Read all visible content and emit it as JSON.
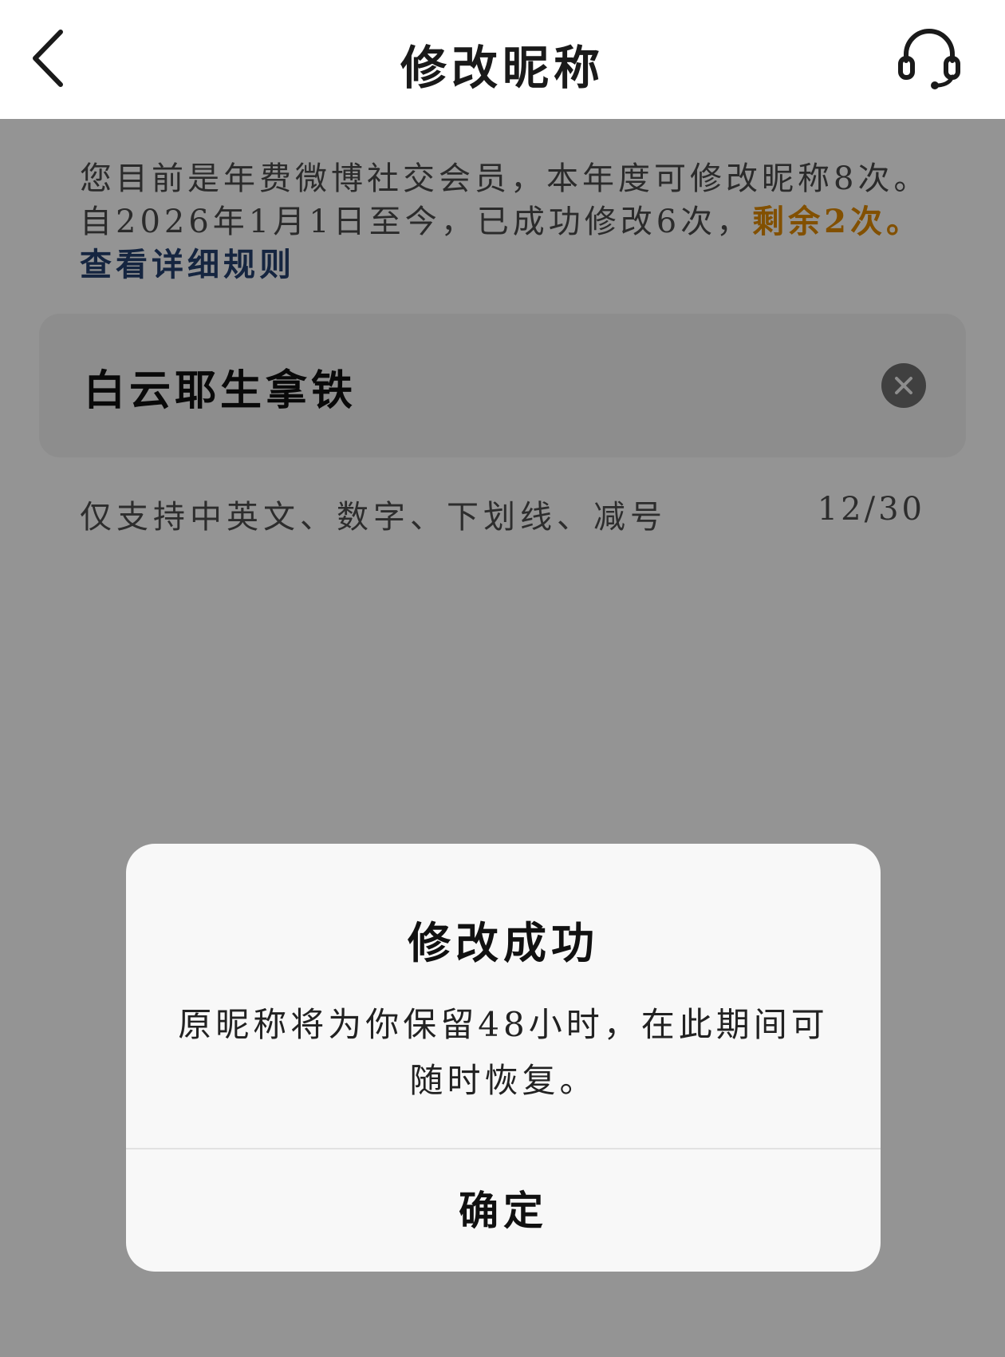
{
  "header": {
    "title": "修改昵称",
    "back_icon": "chevron-left-icon",
    "support_icon": "headset-icon"
  },
  "notice": {
    "text": "您目前是年费微博社交会员，本年度可修改昵称8次。自2026年1月1日至今，已成功修改6次，",
    "remaining": "剩余2次。",
    "rules_link": "查看详细规则",
    "highlight_color": "#e08a00",
    "link_color": "#25406e"
  },
  "nickname_input": {
    "value": "白云耶生拿铁",
    "clear_icon": "clear-icon"
  },
  "hint": {
    "text": "仅支持中英文、数字、下划线、减号",
    "count": "12/30"
  },
  "dialog": {
    "title": "修改成功",
    "message": "原昵称将为你保留48小时，在此期间可随时恢复。",
    "confirm_label": "确定"
  }
}
